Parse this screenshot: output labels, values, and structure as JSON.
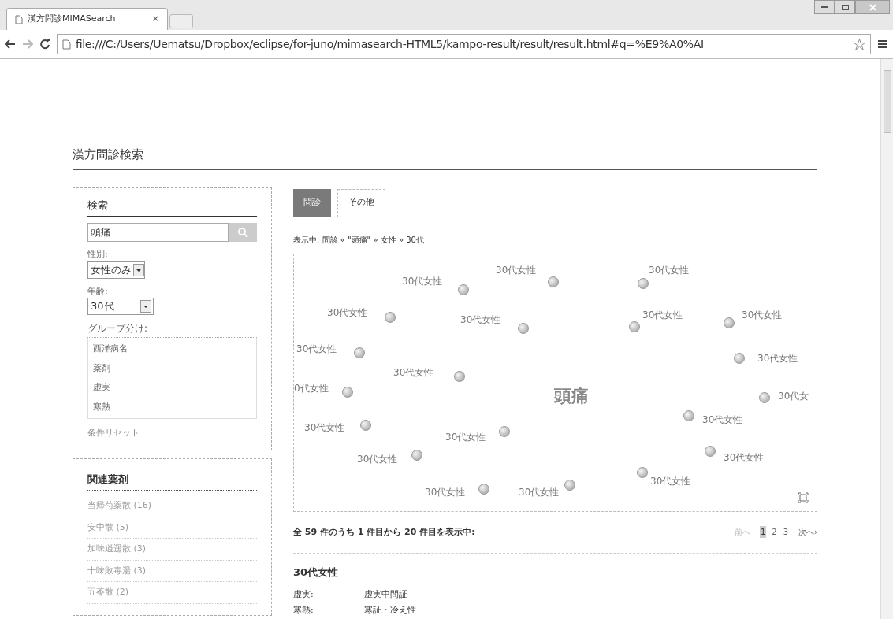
{
  "browser": {
    "tab_title": "漢方問診MIMASearch",
    "tab_close": "×",
    "url": "file:///C:/Users/Uematsu/Dropbox/eclipse/for-juno/mimasearch-HTML5/kampo-result/result/result.html#q=%E9%A0%AI"
  },
  "page_title": "漢方問診検索",
  "search_panel": {
    "title": "検索",
    "query": "頭痛",
    "sex_label": "性別:",
    "sex_value": "女性のみ",
    "age_label": "年齢:",
    "age_value": "30代",
    "group_label": "グループ分け:",
    "group_options": [
      {
        "label": "西洋病名",
        "selected": false
      },
      {
        "label": "薬剤",
        "selected": false
      },
      {
        "label": "虚実",
        "selected": false
      },
      {
        "label": "寒熱",
        "selected": false
      }
    ],
    "reset": "条件リセット"
  },
  "related_panel": {
    "title": "関連薬剤",
    "items": [
      "当帰芍薬散 (16)",
      "安中散 (5)",
      "加味逍遥散 (3)",
      "十味敗毒湯 (3)",
      "五苓散 (2)"
    ]
  },
  "tabs": [
    {
      "label": "問診",
      "selected": true
    },
    {
      "label": "その他",
      "selected": false
    }
  ],
  "filter_summary": "表示中: 問診 « \"頭痛\" » 女性 » 30代",
  "graph": {
    "center": "頭痛",
    "nodes": [
      {
        "label": "30代女性"
      },
      {
        "label": "30代女性"
      },
      {
        "label": "30代女性"
      },
      {
        "label": "30代女性"
      },
      {
        "label": "30代女性"
      },
      {
        "label": "30代女性"
      },
      {
        "label": "30代女性"
      },
      {
        "label": "30代女性"
      },
      {
        "label": "30代女性"
      },
      {
        "label": "30代女性"
      },
      {
        "label": "0代女性"
      },
      {
        "label": "30代女"
      },
      {
        "label": "30代女性"
      },
      {
        "label": "30代女性"
      },
      {
        "label": "30代女性"
      },
      {
        "label": "30代女性"
      },
      {
        "label": "30代女性"
      },
      {
        "label": "30代女性"
      },
      {
        "label": "30代女性"
      },
      {
        "label": "30代女性"
      }
    ]
  },
  "results_summary": "全 59 件のうち 1 件目から 20 件目を表示中:",
  "pagination": {
    "prev": "前へ",
    "pages": [
      {
        "label": "1",
        "selected": true
      },
      {
        "label": "2",
        "selected": false
      },
      {
        "label": "3",
        "selected": false
      }
    ],
    "next": "次へ›"
  },
  "result": {
    "title": "30代女性",
    "fields": [
      {
        "label": "虚実:",
        "value": "虚実中間証"
      },
      {
        "label": "寒熱:",
        "value": "寒証・冷え性"
      }
    ]
  }
}
